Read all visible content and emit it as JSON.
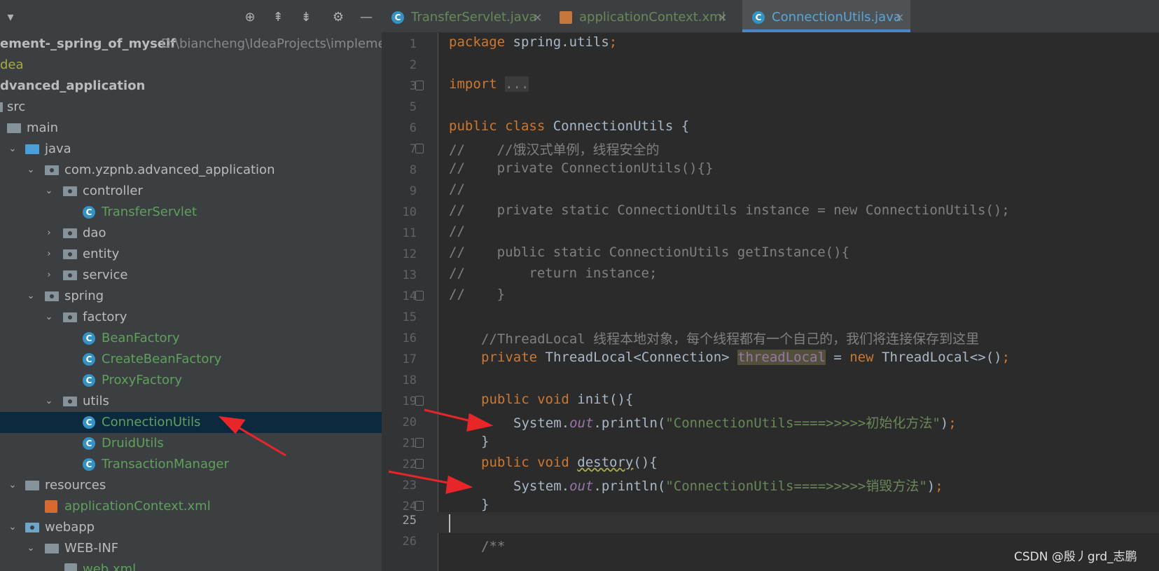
{
  "project": {
    "header_icons": [
      "locate-icon",
      "expand-all-icon",
      "collapse-all-icon",
      "settings-icon",
      "hide-icon"
    ],
    "tree": [
      {
        "label": "ement-_spring_of_myself",
        "suffix": "D:\\biancheng\\IdeaProjects\\impleme",
        "depth": 0,
        "style": "bold"
      },
      {
        "label": "dea",
        "depth": 0,
        "style": "yellowish"
      },
      {
        "label": "dvanced_application",
        "depth": 0,
        "style": "bold"
      },
      {
        "label": "src",
        "depth": 0
      },
      {
        "label": "main",
        "depth": 1
      },
      {
        "label": "java",
        "depth": 1
      },
      {
        "label": "com.yzpnb.advanced_application",
        "depth": 2
      },
      {
        "label": "controller",
        "depth": 3
      },
      {
        "label": "TransferServlet",
        "depth": 4
      },
      {
        "label": "dao",
        "depth": 3
      },
      {
        "label": "entity",
        "depth": 3
      },
      {
        "label": "service",
        "depth": 3
      },
      {
        "label": "spring",
        "depth": 2
      },
      {
        "label": "factory",
        "depth": 3
      },
      {
        "label": "BeanFactory",
        "depth": 4
      },
      {
        "label": "CreateBeanFactory",
        "depth": 4
      },
      {
        "label": "ProxyFactory",
        "depth": 4
      },
      {
        "label": "utils",
        "depth": 3
      },
      {
        "label": "ConnectionUtils",
        "depth": 4,
        "selected": true
      },
      {
        "label": "DruidUtils",
        "depth": 4
      },
      {
        "label": "TransactionManager",
        "depth": 4
      },
      {
        "label": "resources",
        "depth": 1
      },
      {
        "label": "applicationContext.xml",
        "depth": 2
      },
      {
        "label": "webapp",
        "depth": 1
      },
      {
        "label": "WEB-INF",
        "depth": 2
      },
      {
        "label": "web.xml",
        "depth": 3
      }
    ]
  },
  "tabs": [
    {
      "label": "TransferServlet.java",
      "close": "×"
    },
    {
      "label": "applicationContext.xml",
      "close": "×"
    },
    {
      "label": "ConnectionUtils.java",
      "close": "×",
      "active": true
    }
  ],
  "editor": {
    "line_numbers": [
      "1",
      "2",
      "3",
      "5",
      "6",
      "7",
      "8",
      "9",
      "10",
      "11",
      "12",
      "13",
      "14",
      "15",
      "16",
      "17",
      "18",
      "19",
      "20",
      "21",
      "22",
      "23",
      "24",
      "25",
      "26"
    ],
    "lines": {
      "l1_kw": "package",
      "l1_rest": " spring.utils",
      "l1_semi": ";",
      "l3_kw": "import",
      "l3_dots": "...",
      "l6_kw": "public class",
      "l6_rest": " ConnectionUtils {",
      "l7": "//    //饿汉式单例，线程安全的",
      "l8": "//    private ConnectionUtils(){}",
      "l9": "//",
      "l10": "//    private static ConnectionUtils instance = new ConnectionUtils();",
      "l11": "//",
      "l12": "//    public static ConnectionUtils getInstance(){",
      "l13": "//        return instance;",
      "l14": "//    }",
      "l16": "//ThreadLocal 线程本地对象，每个线程都有一个自己的，我们将连接保存到这里",
      "l17_kw": "private",
      "l17_type": " ThreadLocal<Connection> ",
      "l17_var": "threadLocal",
      "l17_eq": " = ",
      "l17_new": "new",
      "l17_rest": " ThreadLocal<>()",
      "l17_semi": ";",
      "l19_kw": "public void",
      "l19_fn": " init",
      "l19_rest": "(){",
      "l20_sys": "System.",
      "l20_out": "out",
      "l20_call": ".println(",
      "l20_str": "\"ConnectionUtils====>>>>>初始化方法\"",
      "l20_end": ")",
      "l20_semi": ";",
      "l21": "}",
      "l22_kw": "public void",
      "l22_fn": "destory",
      "l22_rest": "(){",
      "l23_sys": "System.",
      "l23_out": "out",
      "l23_call": ".println(",
      "l23_str": "\"ConnectionUtils====>>>>>销毁方法\"",
      "l23_end": ")",
      "l23_semi": ";",
      "l24": "}",
      "l26": "/**"
    }
  },
  "colors": {
    "annotation_arrow": "#e8262a",
    "selection": "#0d293e",
    "keyword": "#cc7832",
    "string": "#6a8759",
    "comment": "#808080"
  },
  "watermark": "CSDN @殷丿grd_志鹏"
}
